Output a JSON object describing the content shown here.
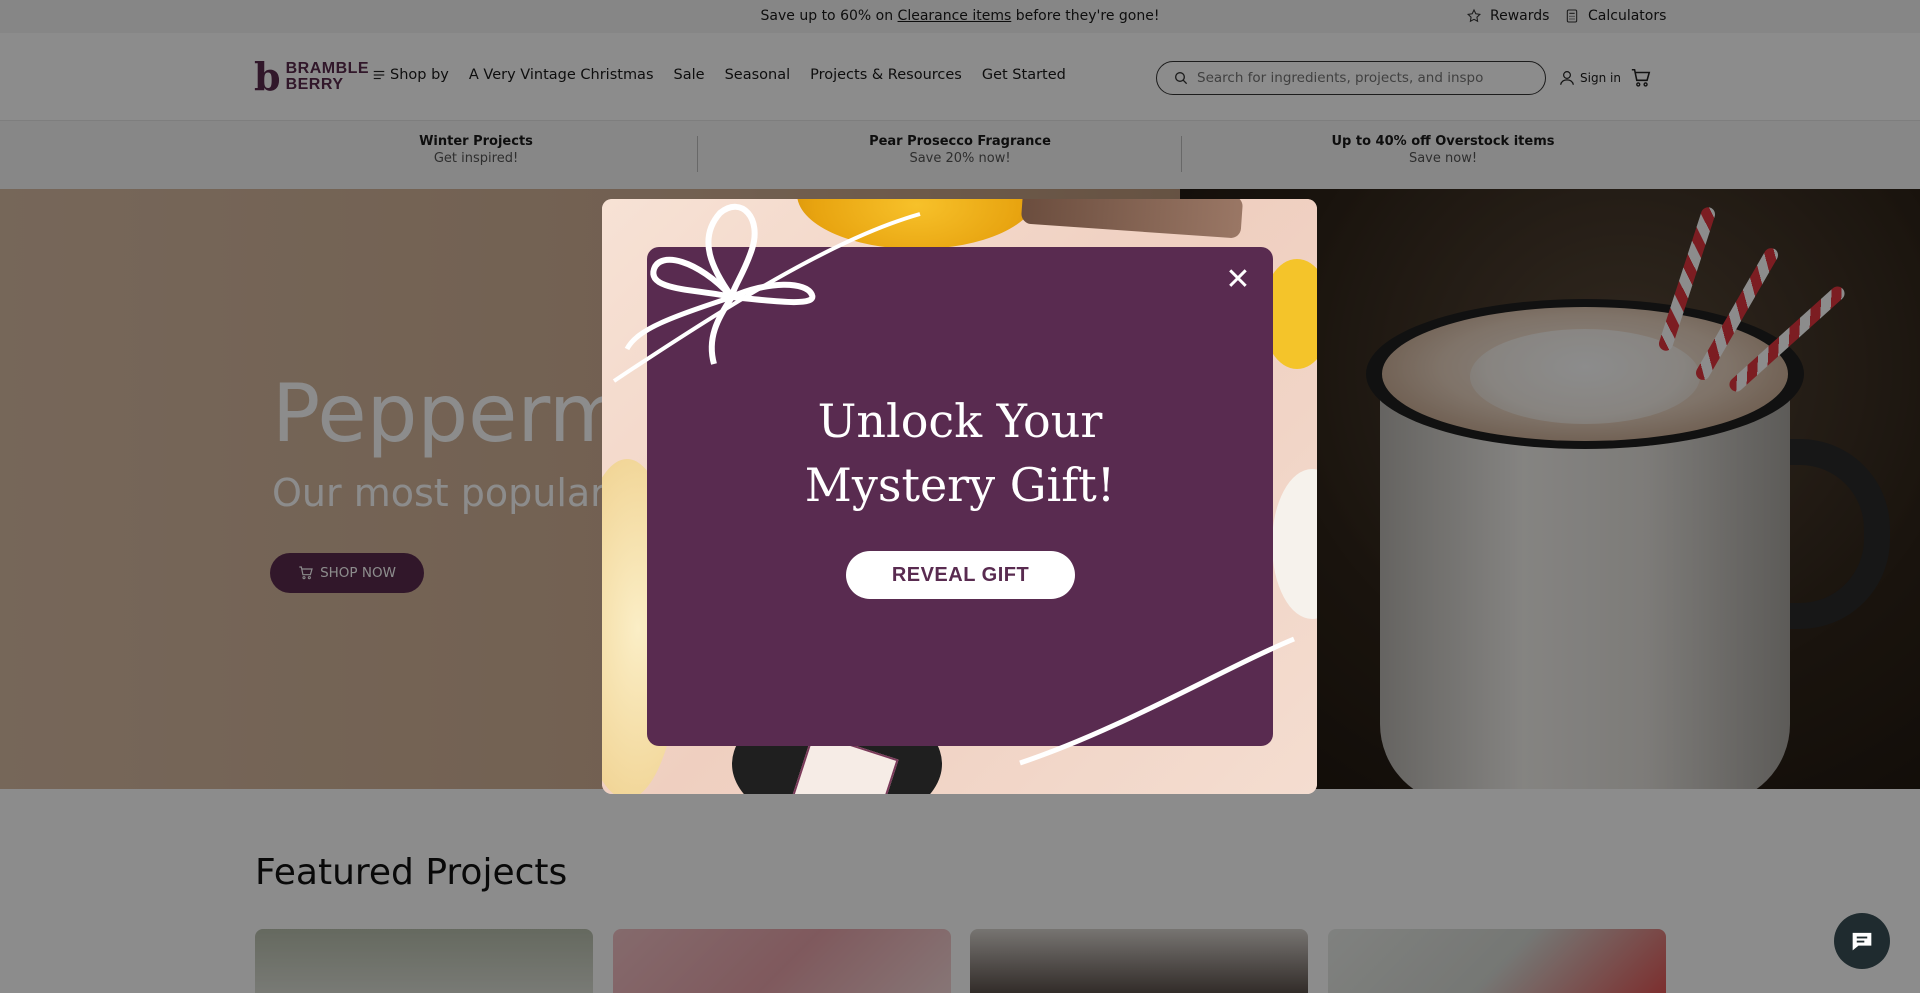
{
  "topbar": {
    "promo_prefix": "Save up to 60% on",
    "promo_link": "Clearance items",
    "promo_suffix": "before they're gone!",
    "rewards": "Rewards",
    "calculators": "Calculators"
  },
  "header": {
    "logo_line1": "BRAMBLE",
    "logo_line2": "BERRY",
    "nav": [
      "Shop by",
      "A Very Vintage Christmas",
      "Sale",
      "Seasonal",
      "Projects & Resources",
      "Get Started"
    ],
    "search_placeholder": "Search for ingredients, projects, and inspo",
    "signin": "Sign in"
  },
  "promostrip": [
    {
      "title": "Winter Projects",
      "sub": "Get inspired!"
    },
    {
      "title": "Pear Prosecco Fragrance",
      "sub": "Save 20% now!"
    },
    {
      "title": "Up to 40% off Overstock items",
      "sub": "Save now!"
    }
  ],
  "hero": {
    "title": "Pepperm",
    "subtitle": "Our most popular",
    "cta": "SHOP NOW"
  },
  "featured": {
    "title": "Featured Projects"
  },
  "modal": {
    "title_line1": "Unlock Your",
    "title_line2": "Mystery Gift!",
    "cta": "REVEAL GIFT",
    "close": "✕"
  },
  "colors": {
    "brand_plum": "#592b50",
    "overlay": "rgba(0,0,0,0.45)"
  },
  "icons": [
    "star-icon",
    "calculator-icon",
    "menu-icon",
    "search-icon",
    "user-icon",
    "cart-icon",
    "close-icon",
    "chat-icon"
  ]
}
